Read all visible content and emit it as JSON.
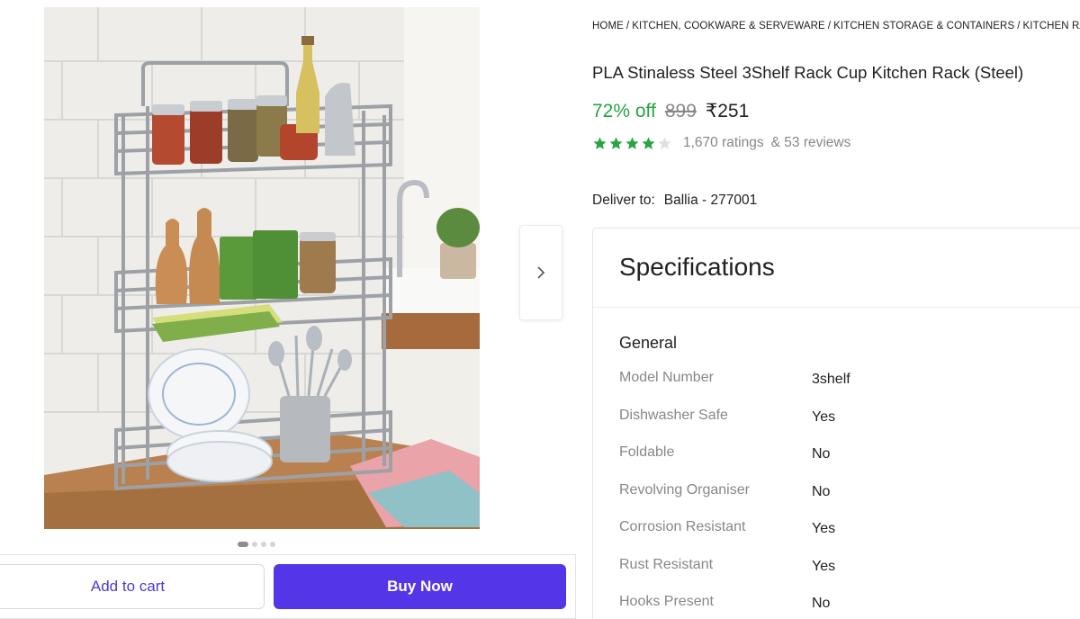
{
  "breadcrumb": [
    "HOME",
    "KITCHEN, COOKWARE & SERVEWARE",
    "KITCHEN STORAGE & CONTAINERS",
    "KITCHEN RACKS"
  ],
  "product": {
    "title": "PLA Stinaless Steel 3Shelf Rack Cup Kitchen Rack (Steel)",
    "discount": "72% off",
    "mrp": "899",
    "price": "₹251",
    "rating_value": 4,
    "rating_max": 5,
    "ratings_text": "1,670 ratings",
    "reviews_text": "& 53 reviews",
    "star_color": "#26a541"
  },
  "delivery": {
    "label": "Deliver to:",
    "location": "Ballia - 277001"
  },
  "gallery": {
    "image_count": 4,
    "active_index": 0,
    "next_icon": "chevron-right-icon"
  },
  "actions": {
    "add_to_cart": "Add to cart",
    "buy_now": "Buy Now",
    "buy_color": "#5436e8"
  },
  "specifications": {
    "title": "Specifications",
    "group": "General",
    "rows": [
      {
        "key": "Model Number",
        "value": "3shelf"
      },
      {
        "key": "Dishwasher Safe",
        "value": "Yes"
      },
      {
        "key": "Foldable",
        "value": "No"
      },
      {
        "key": "Revolving Organiser",
        "value": "No"
      },
      {
        "key": "Corrosion Resistant",
        "value": "Yes"
      },
      {
        "key": "Rust Resistant",
        "value": "Yes"
      },
      {
        "key": "Hooks Present",
        "value": "No"
      }
    ]
  }
}
